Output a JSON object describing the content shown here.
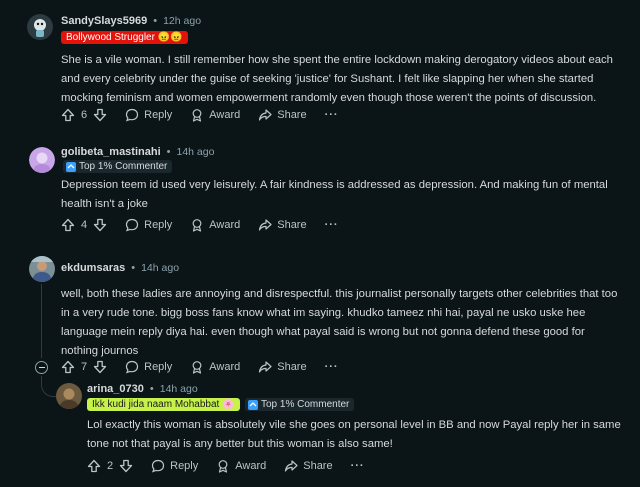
{
  "comments": [
    {
      "username": "SandySlays5969",
      "time": "12h ago",
      "flair": "Bollywood Struggler 😠😠",
      "body": "She is a vile woman. I still remember how she spent the entire lockdown making derogatory videos about each and every celebrity under the guise of seeking 'justice' for Sushant. I felt like slapping her when she started mocking feminism and women empowerment randomly even though those weren't the points of discussion.",
      "votes": "6",
      "reply": "Reply",
      "award": "Award",
      "share": "Share",
      "more": "···"
    },
    {
      "username": "golibeta_mastinahi",
      "time": "14h ago",
      "flair": "Top 1% Commenter",
      "body": "Depression teem id used very leisurely. A fair kindness is addressed as depression. And making fun of mental health isn't a joke",
      "votes": "4",
      "reply": "Reply",
      "award": "Award",
      "share": "Share",
      "more": "···"
    },
    {
      "username": "ekdumsaras",
      "time": "14h ago",
      "body": "well, both these ladies are annoying and disrespectful. this journalist personally targets other celebrities that too in a very rude tone. bigg boss fans know what im saying. khudko tameez nhi hai, payal ne usko uske hee language mein reply diya hai. even though what payal said is wrong but not gonna defend these good for nothing journos",
      "votes": "7",
      "reply": "Reply",
      "award": "Award",
      "share": "Share",
      "more": "···"
    },
    {
      "username": "arina_0730",
      "time": "14h ago",
      "flair1": "Ikk kudi jida naam Mohabbat 🌸",
      "flair2": "Top 1% Commenter",
      "body": "Lol exactly this woman is absolutely vile she goes on personal level in BB and now Payal reply her in same tone not that payal is any better but this woman is also same!",
      "votes": "2",
      "reply": "Reply",
      "award": "Award",
      "share": "Share",
      "more": "···"
    }
  ],
  "colors": {
    "bg": "#0b1416",
    "flair_red": "#e3120b",
    "flair_green": "#c6f24b"
  }
}
